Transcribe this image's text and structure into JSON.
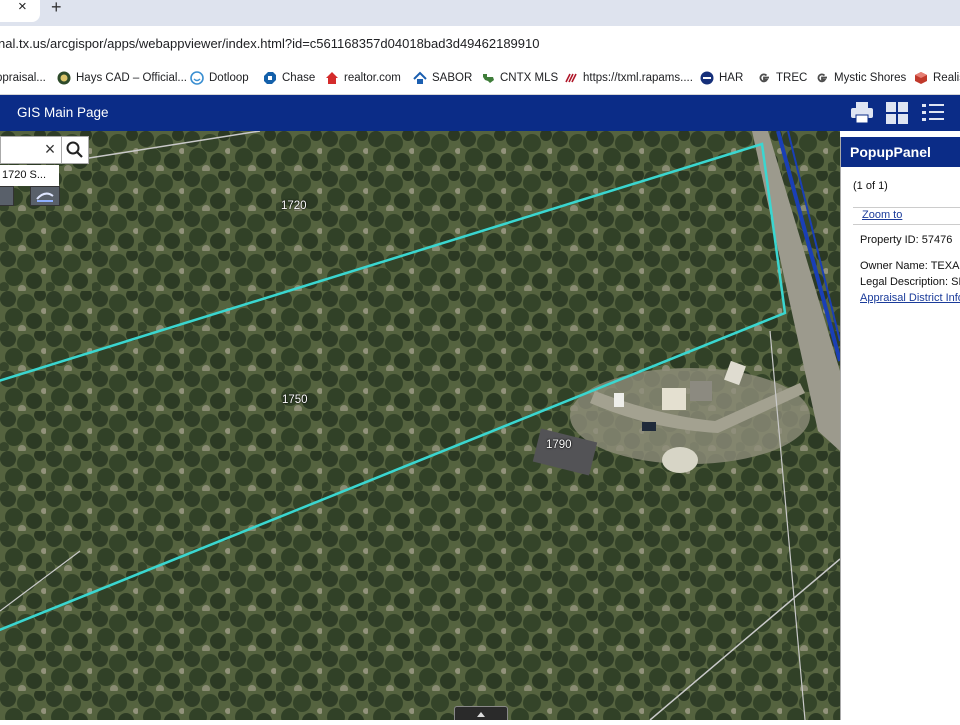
{
  "browser": {
    "tab_close": "×",
    "new_tab": "+",
    "url": "nal.tx.us/arcgispor/apps/webappviewer/index.html?id=c561168357d04018bad3d49462189910",
    "bookmarks": [
      {
        "label": "ppraisal...",
        "icon": "appraisal-icon"
      },
      {
        "label": "Hays CAD – Official...",
        "icon": "hays-cad-icon"
      },
      {
        "label": "Dotloop",
        "icon": "dotloop-icon"
      },
      {
        "label": "Chase",
        "icon": "chase-icon"
      },
      {
        "label": "realtor.com",
        "icon": "realtor-icon"
      },
      {
        "label": "SABOR",
        "icon": "sabor-icon"
      },
      {
        "label": "CNTX MLS",
        "icon": "cntx-mls-icon"
      },
      {
        "label": "https://txml.rapams....",
        "icon": "rapams-icon"
      },
      {
        "label": "HAR",
        "icon": "har-icon"
      },
      {
        "label": "TREC",
        "icon": "google-icon"
      },
      {
        "label": "Mystic Shores",
        "icon": "google-icon"
      },
      {
        "label": "Realis",
        "icon": "realist-icon"
      }
    ]
  },
  "app": {
    "title": "GIS Main Page",
    "icons": [
      "print-icon",
      "basemap-gallery-icon",
      "layer-list-icon"
    ]
  },
  "map": {
    "search_clear": "×",
    "search_suggestion": "1720 S...",
    "parcel_labels": [
      "1720",
      "1750",
      "1790"
    ],
    "highlight_color": "#3ad6d0"
  },
  "popup": {
    "title": "PopupPanel",
    "count": "(1 of 1)",
    "zoom_to": "Zoom to",
    "property_id": "Property ID: 57476",
    "owner_name": "Owner Name: TEXAS",
    "legal_description": "Legal Description: SH",
    "appraisal_link": "Appraisal District Info"
  }
}
